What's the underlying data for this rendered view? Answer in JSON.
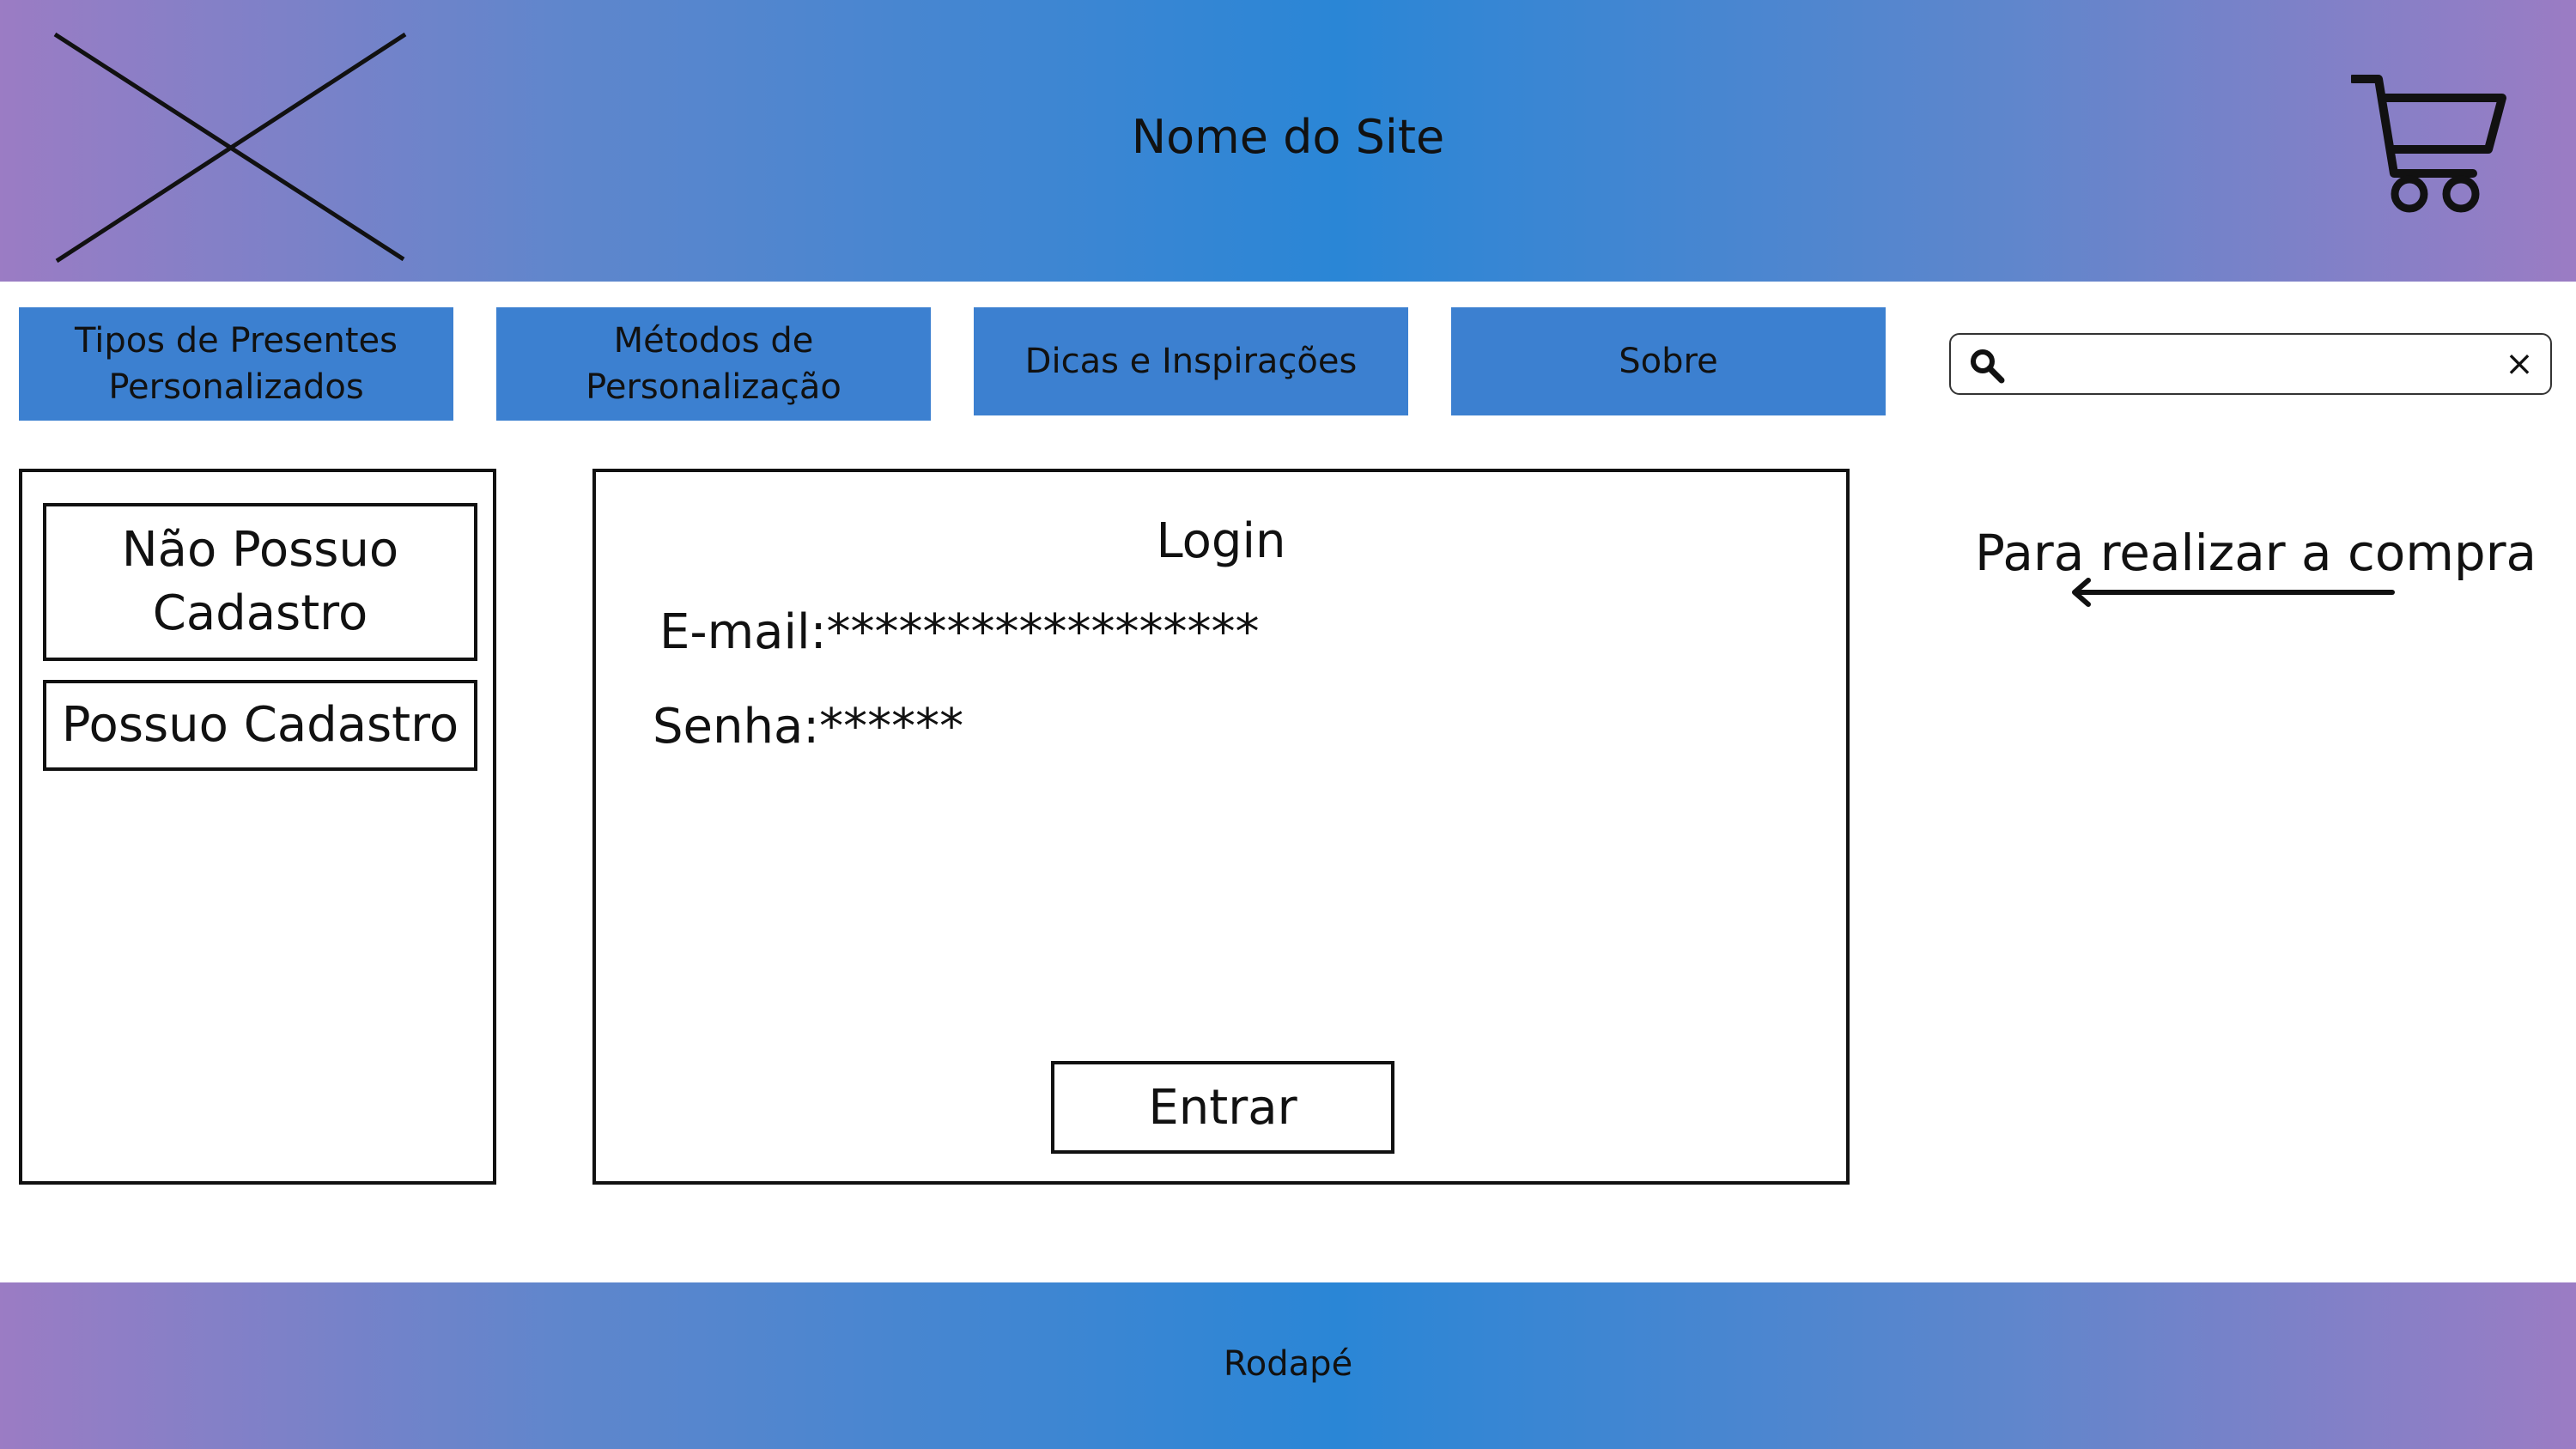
{
  "header": {
    "site_title": "Nome do Site",
    "logo_icon": "image-placeholder-x-icon",
    "cart_icon": "shopping-cart-icon"
  },
  "nav": {
    "items": [
      {
        "label": "Tipos de Presentes Personalizados"
      },
      {
        "label": "Métodos de Personalização"
      },
      {
        "label": "Dicas e Inspirações"
      },
      {
        "label": "Sobre"
      }
    ]
  },
  "search": {
    "value": "",
    "placeholder": "",
    "search_icon": "search-icon",
    "clear_label": "×"
  },
  "left_panel": {
    "no_account_label": "Não Possuo Cadastro",
    "has_account_label": "Possuo Cadastro"
  },
  "login": {
    "title": "Login",
    "email_text": "E-mail:******************",
    "password_text": "Senha:******",
    "submit_label": "Entrar"
  },
  "hint": {
    "text": "Para realizar a compra",
    "arrow_icon": "left-arrow-icon"
  },
  "footer": {
    "text": "Rodapé"
  },
  "colors": {
    "gradient_edge": "#9b7cc4",
    "gradient_center": "#2a86d6",
    "nav_button": "#3c80d0"
  }
}
